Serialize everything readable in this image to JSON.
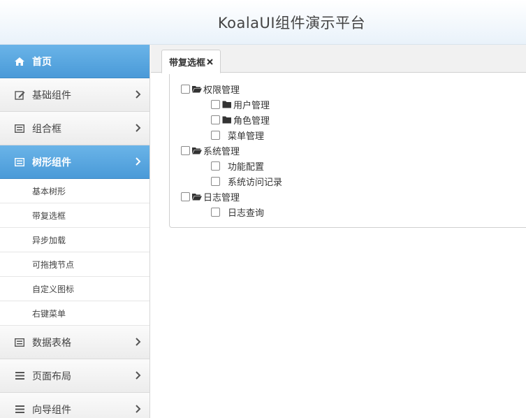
{
  "header": {
    "title": "KoalaUI组件演示平台"
  },
  "sidebar": {
    "items": [
      {
        "label": "首页",
        "icon": "home-icon"
      },
      {
        "label": "基础组件",
        "icon": "edit-icon"
      },
      {
        "label": "组合框",
        "icon": "list-box-icon"
      },
      {
        "label": "树形组件",
        "icon": "list-box-icon"
      },
      {
        "label": "数据表格",
        "icon": "list-box-icon"
      },
      {
        "label": "页面布局",
        "icon": "bars-icon"
      },
      {
        "label": "向导组件",
        "icon": "bars-icon"
      }
    ],
    "tree_sub_items": [
      "基本树形",
      "带复选框",
      "异步加载",
      "可拖拽节点",
      "自定义图标",
      "右键菜单"
    ]
  },
  "tabs": [
    {
      "label": "带复选框",
      "close_icon": "close-icon"
    }
  ],
  "tree": {
    "nodes": [
      {
        "label": "权限管理",
        "type": "folder-open",
        "checked": false
      },
      {
        "label": "用户管理",
        "type": "folder",
        "checked": false
      },
      {
        "label": "角色管理",
        "type": "folder",
        "checked": false
      },
      {
        "label": "菜单管理",
        "type": "leaf",
        "checked": false
      },
      {
        "label": "系统管理",
        "type": "folder-open",
        "checked": false
      },
      {
        "label": "功能配置",
        "type": "leaf",
        "checked": false
      },
      {
        "label": "系统访问记录",
        "type": "leaf",
        "checked": false
      },
      {
        "label": "日志管理",
        "type": "folder-open",
        "checked": false
      },
      {
        "label": "日志查询",
        "type": "leaf",
        "checked": false
      }
    ]
  },
  "colors": {
    "active_nav": "#4a9ad8",
    "header_bg": "#e9f2fa"
  }
}
